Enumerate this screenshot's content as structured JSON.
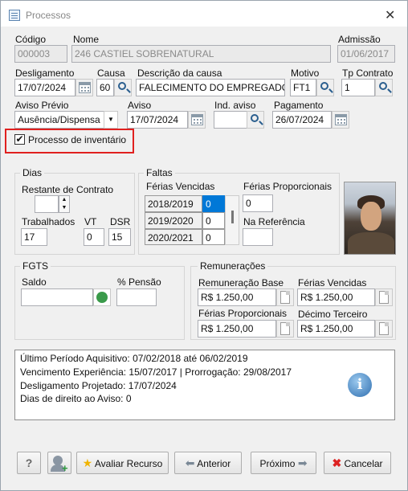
{
  "window": {
    "title": "Processos",
    "close": "✕"
  },
  "fields": {
    "codigo": {
      "label": "Código",
      "value": "000003"
    },
    "nome": {
      "label": "Nome",
      "value": "246 CASTIEL SOBRENATURAL"
    },
    "admissao": {
      "label": "Admissão",
      "value": "01/06/2017"
    },
    "desligamento": {
      "label": "Desligamento",
      "value": "17/07/2024"
    },
    "causa": {
      "label": "Causa",
      "value": "60"
    },
    "descricao": {
      "label": "Descrição da causa",
      "value": "FALECIMENTO DO EMPREGADO"
    },
    "motivo": {
      "label": "Motivo",
      "value": "FT1"
    },
    "tp_contrato": {
      "label": "Tp Contrato",
      "value": "1"
    },
    "aviso_previo": {
      "label": "Aviso Prévio",
      "value": "Ausência/Dispensa"
    },
    "aviso": {
      "label": "Aviso",
      "value": "17/07/2024"
    },
    "ind_aviso": {
      "label": "Ind. aviso",
      "value": ""
    },
    "pagamento": {
      "label": "Pagamento",
      "value": "26/07/2024"
    },
    "inventario": {
      "label": "Processo de inventário",
      "checked": true
    }
  },
  "dias": {
    "title": "Dias",
    "restante_label": "Restante de Contrato",
    "restante_value": "",
    "trabalhados_label": "Trabalhados",
    "trabalhados_value": "17",
    "vt_label": "VT",
    "vt_value": "0",
    "dsr_label": "DSR",
    "dsr_value": "15"
  },
  "faltas": {
    "title": "Faltas",
    "vencidas_label": "Férias Vencidas",
    "rows": [
      {
        "year": "2018/2019",
        "value": "0"
      },
      {
        "year": "2019/2020",
        "value": "0"
      },
      {
        "year": "2020/2021",
        "value": "0"
      }
    ],
    "proporcionais_label": "Férias Proporcionais",
    "proporcionais_value": "0",
    "referencia_label": "Na Referência",
    "referencia_value": ""
  },
  "fgts": {
    "title": "FGTS",
    "saldo_label": "Saldo",
    "saldo_value": "",
    "pensao_label": "% Pensão",
    "pensao_value": ""
  },
  "remuneracoes": {
    "title": "Remunerações",
    "base_label": "Remuneração Base",
    "base_value": "R$ 1.250,00",
    "vencidas_label": "Férias Vencidas",
    "vencidas_value": "R$ 1.250,00",
    "proporcionais_label": "Férias Proporcionais",
    "proporcionais_value": "R$ 1.250,00",
    "decimo_label": "Décimo Terceiro",
    "decimo_value": "R$ 1.250,00"
  },
  "info": {
    "line1": "Último Período Aquisitivo: 07/02/2018 até 06/02/2019",
    "line2": "Vencimento Experiência: 15/07/2017 | Prorrogação: 29/08/2017",
    "line3": "Desligamento Projetado: 17/07/2024",
    "line4": "Dias de direito ao Aviso: 0"
  },
  "buttons": {
    "help": "?",
    "avaliar": "Avaliar Recurso",
    "anterior": "Anterior",
    "proximo": "Próximo",
    "cancelar": "Cancelar"
  },
  "colors": {
    "highlight": "#e0201f",
    "selection": "#0078d7",
    "accent": "#2b5f8f"
  }
}
